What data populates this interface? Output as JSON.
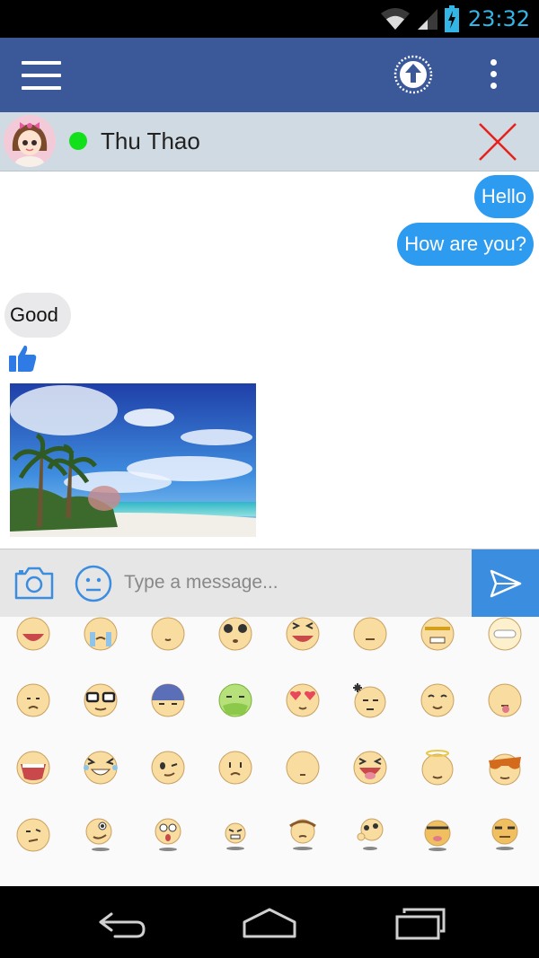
{
  "status_bar": {
    "time": "23:32",
    "wifi_icon": "wifi-icon",
    "signal_icon": "cell-signal-icon",
    "battery_icon": "battery-charging-icon",
    "color": "#33b5e5"
  },
  "app_bar": {
    "background": "#3b5998",
    "menu_icon": "hamburger-icon",
    "upload_icon": "upload-circle-icon",
    "more_icon": "overflow-menu-icon"
  },
  "chat_header": {
    "contact_name": "Thu Thao",
    "status_color": "#12e01a",
    "close_icon": "close-icon"
  },
  "messages": [
    {
      "direction": "outgoing",
      "text": "Hello"
    },
    {
      "direction": "outgoing",
      "text": "How are you?"
    },
    {
      "direction": "incoming",
      "text": "Good"
    },
    {
      "direction": "incoming",
      "type": "sticker",
      "icon": "thumbs-up-icon"
    },
    {
      "direction": "incoming",
      "type": "image",
      "icon": "beach-photo"
    }
  ],
  "composer": {
    "placeholder": "Type a message...",
    "value": "",
    "camera_icon": "camera-icon",
    "emoji_icon": "smiley-icon",
    "send_icon": "send-icon"
  },
  "emoji_grid": [
    [
      "laughing",
      "crying",
      "sleepy",
      "surprised",
      "squinting-laugh",
      "neutral",
      "annoyed",
      "grinning-teeth"
    ],
    [
      "sad",
      "nerd-glasses",
      "shocked-blue",
      "sick-green",
      "heart-eyes",
      "angry-vein",
      "smile",
      "tongue-out"
    ],
    [
      "big-laugh",
      "tears-of-joy",
      "wink",
      "frown",
      "blank",
      "tongue-laugh",
      "angel",
      "cool-sunglasses"
    ],
    [
      "confused",
      "pointing",
      "scared",
      "grumpy",
      "pouting",
      "thinking",
      "tired",
      "unamused"
    ]
  ],
  "nav_bar": {
    "back_icon": "back-icon",
    "home_icon": "home-icon",
    "recents_icon": "recent-apps-icon"
  }
}
